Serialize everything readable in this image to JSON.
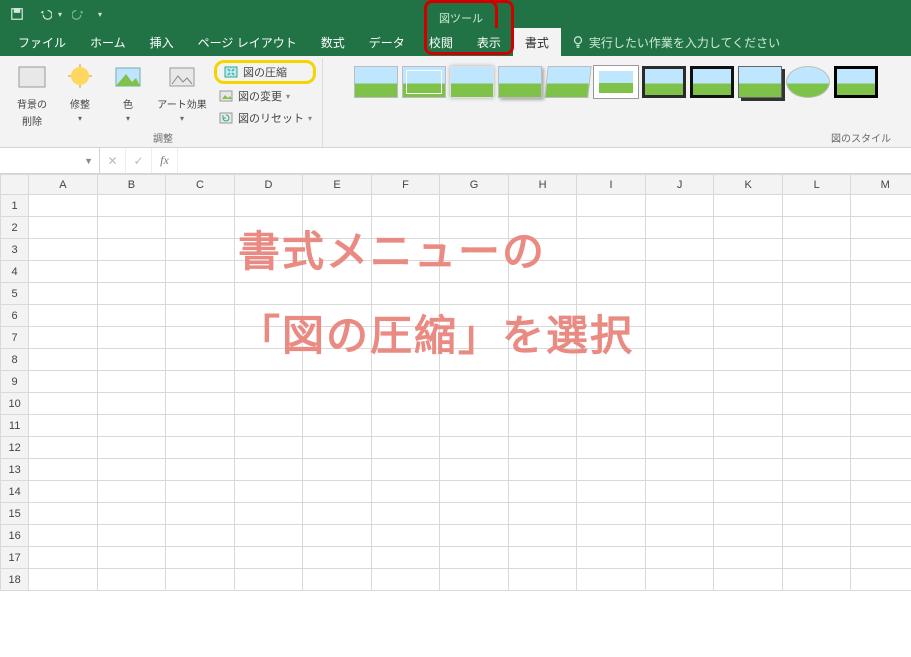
{
  "qat": {
    "save": "保存",
    "undo": "元に戻す",
    "redo": "やり直し"
  },
  "contextual_tab_group": "図ツール",
  "tabs": {
    "file": "ファイル",
    "home": "ホーム",
    "insert": "挿入",
    "pagelayout": "ページ レイアウト",
    "formulas": "数式",
    "data": "データ",
    "review": "校閲",
    "view": "表示",
    "format": "書式"
  },
  "tellme_placeholder": "実行したい作業を入力してください",
  "ribbon": {
    "adjust": {
      "remove_bg": {
        "line1": "背景の",
        "line2": "削除"
      },
      "corrections": "修整",
      "color": "色",
      "artistic": "アート効果",
      "compress": "図の圧縮",
      "change": "図の変更",
      "reset": "図のリセット",
      "group_label": "調整"
    },
    "styles_group_label": "図のスタイル"
  },
  "formula_bar": {
    "namebox": "",
    "fx": "fx",
    "formula": ""
  },
  "columns": [
    "A",
    "B",
    "C",
    "D",
    "E",
    "F",
    "G",
    "H",
    "I",
    "J",
    "K",
    "L",
    "M"
  ],
  "rows": [
    1,
    2,
    3,
    4,
    5,
    6,
    7,
    8,
    9,
    10,
    11,
    12,
    13,
    14,
    15,
    16,
    17,
    18
  ],
  "overlay": {
    "line1": "書式メニューの",
    "line2": "「図の圧縮」を選択"
  }
}
